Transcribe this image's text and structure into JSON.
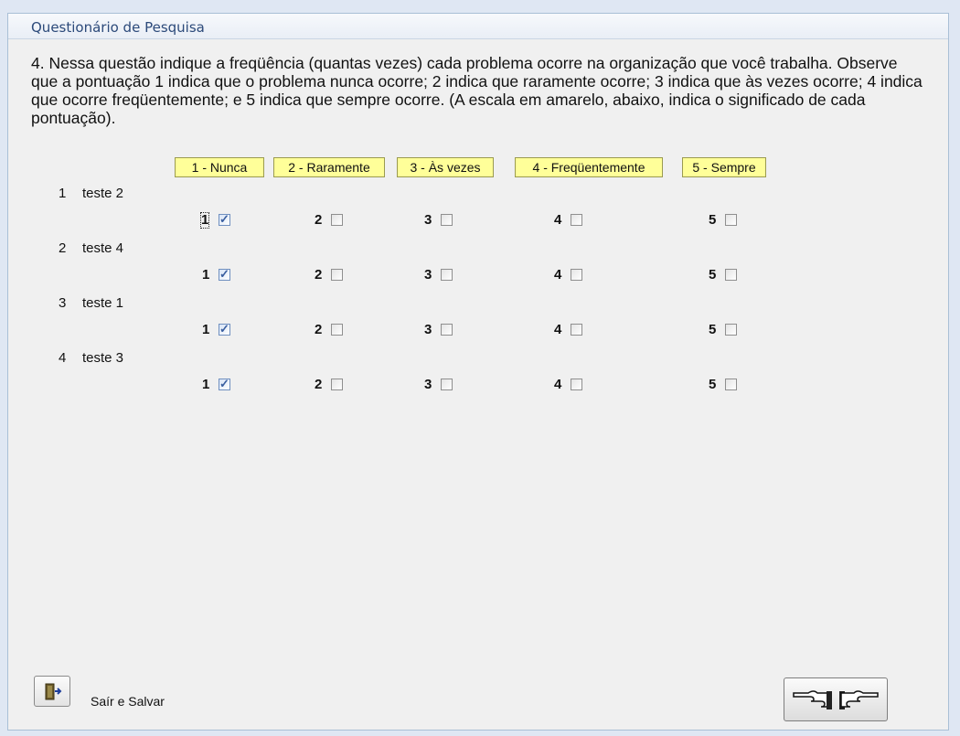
{
  "window": {
    "title": "Questionário de Pesquisa"
  },
  "question": "4. Nessa questão indique a freqüência (quantas vezes) cada problema ocorre na organização que você trabalha. Observe que a pontuação 1 indica que o problema nunca ocorre; 2 indica que raramente ocorre; 3 indica que às vezes ocorre; 4 indica que ocorre freqüentemente; e 5 indica que sempre ocorre. (A escala em amarelo, abaixo, indica o significado de cada pontuação).",
  "scale": [
    {
      "label": "1 - Nunca"
    },
    {
      "label": "2 - Raramente"
    },
    {
      "label": "3 - Às vezes"
    },
    {
      "label": "4 - Freqüentemente"
    },
    {
      "label": "5 - Sempre"
    }
  ],
  "items": [
    {
      "number": "1",
      "text": "teste 2",
      "selected": 1
    },
    {
      "number": "2",
      "text": "teste 4",
      "selected": 1
    },
    {
      "number": "3",
      "text": "teste 1",
      "selected": 1
    },
    {
      "number": "4",
      "text": "teste 3",
      "selected": 1
    }
  ],
  "option_digits": [
    "1",
    "2",
    "3",
    "4",
    "5"
  ],
  "buttons": {
    "exit_label": "Saír e Salvar",
    "exit_icon": "exit-door-icon",
    "nav_icon": "pointing-hands-icon"
  },
  "colors": {
    "scale_bg": "#ffff99",
    "title_text": "#2c4a7a"
  }
}
